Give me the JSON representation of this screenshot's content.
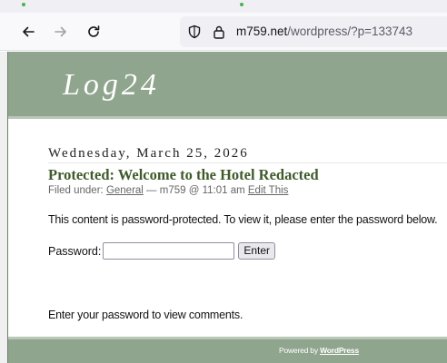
{
  "browser": {
    "url_domain": "m759.net",
    "url_path": "/wordpress/?p=133743"
  },
  "blog": {
    "title": "Log24"
  },
  "post": {
    "date": "Wednesday, March 25, 2026",
    "title": "Protected: Welcome to the Hotel Redacted",
    "meta_prefix": "Filed under: ",
    "category": "General",
    "meta_middle": " — m759 @ 11:01 am ",
    "edit_link": "Edit This",
    "protected_message": "This content is password-protected. To view it, please enter the password below.",
    "password_label": "Password:",
    "password_value": "",
    "submit_label": "Enter",
    "comments_message": "Enter your password to view comments."
  },
  "footer": {
    "powered_prefix": "Powered by ",
    "powered_link": "WordPress"
  },
  "colors": {
    "header_green": "#8fa58e",
    "title_green": "#3e5a2a"
  }
}
